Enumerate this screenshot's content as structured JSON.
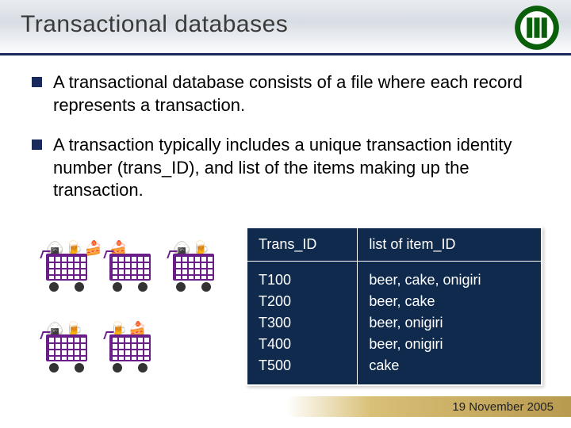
{
  "title": "Transactional databases",
  "bullets": [
    "A transactional database consists of a file where each record represents a transaction.",
    "A transaction typically includes a unique transaction identity number (trans_ID), and list of the items making up the transaction."
  ],
  "table": {
    "headers": [
      "Trans_ID",
      "list of item_ID"
    ],
    "rows": [
      [
        "T100",
        "beer, cake, onigiri"
      ],
      [
        "T200",
        "beer, cake"
      ],
      [
        "T300",
        "beer, onigiri"
      ],
      [
        "T400",
        "beer, onigiri"
      ],
      [
        "T500",
        "cake"
      ]
    ]
  },
  "cart_items": {
    "c0": [
      "🍙",
      "🍺",
      "🍰"
    ],
    "c1": [
      "🍰"
    ],
    "c2": [
      "🍙",
      "🍺"
    ],
    "c3": [
      "🍙",
      "🍺"
    ],
    "c4": [
      "🍺",
      "🍰"
    ]
  },
  "footer_date": "19 November 2005",
  "chart_data": {
    "type": "table",
    "title": "Transactional database example",
    "columns": [
      "Trans_ID",
      "list of item_ID"
    ],
    "rows": [
      {
        "Trans_ID": "T100",
        "items": [
          "beer",
          "cake",
          "onigiri"
        ]
      },
      {
        "Trans_ID": "T200",
        "items": [
          "beer",
          "cake"
        ]
      },
      {
        "Trans_ID": "T300",
        "items": [
          "beer",
          "onigiri"
        ]
      },
      {
        "Trans_ID": "T400",
        "items": [
          "beer",
          "onigiri"
        ]
      },
      {
        "Trans_ID": "T500",
        "items": [
          "cake"
        ]
      }
    ]
  }
}
